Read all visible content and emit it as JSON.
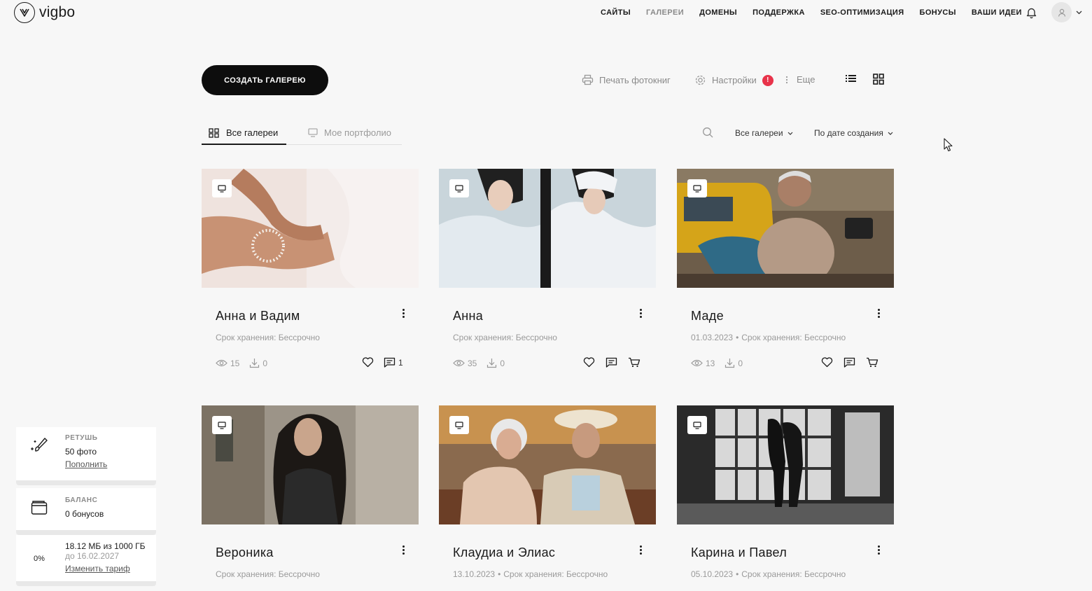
{
  "header": {
    "logo_text": "vigbo",
    "nav": [
      {
        "label": "САЙТЫ",
        "active": false
      },
      {
        "label": "ГАЛЕРЕИ",
        "active": true
      },
      {
        "label": "ДОМЕНЫ",
        "active": false
      },
      {
        "label": "ПОДДЕРЖКА",
        "active": false
      },
      {
        "label": "SEO-ОПТИМИЗАЦИЯ",
        "active": false
      },
      {
        "label": "БОНУСЫ",
        "active": false
      },
      {
        "label": "ВАШИ ИДЕИ",
        "active": false
      }
    ]
  },
  "toolbar": {
    "create_label": "СОЗДАТЬ ГАЛЕРЕЮ",
    "print_label": "Печать фотокниг",
    "settings_label": "Настройки",
    "settings_badge": "!",
    "more_label": "Еще"
  },
  "tabs": {
    "all_label": "Все галереи",
    "portfolio_label": "Мое портфолио"
  },
  "filters": {
    "scope": "Все галереи",
    "sort": "По дате создания"
  },
  "galleries": [
    {
      "title": "Анна и Вадим",
      "date": "",
      "storage": "Срок хранения: Бессрочно",
      "views": "15",
      "downloads": "0",
      "comments": "1",
      "cart": false
    },
    {
      "title": "Анна",
      "date": "",
      "storage": "Срок хранения: Бессрочно",
      "views": "35",
      "downloads": "0",
      "comments": "",
      "cart": true
    },
    {
      "title": "Маде",
      "date": "01.03.2023",
      "storage": "Срок хранения: Бессрочно",
      "views": "13",
      "downloads": "0",
      "comments": "",
      "cart": true
    },
    {
      "title": "Вероника",
      "date": "",
      "storage": "Срок хранения: Бессрочно"
    },
    {
      "title": "Клаудиа и Элиас",
      "date": "13.10.2023",
      "storage": "Срок хранения: Бессрочно"
    },
    {
      "title": "Карина и Павел",
      "date": "05.10.2023",
      "storage": "Срок хранения: Бессрочно"
    }
  ],
  "sidebar": {
    "retouch": {
      "label": "РЕТУШЬ",
      "value": "50 фото",
      "link": "Пополнить"
    },
    "balance": {
      "label": "БАЛАНС",
      "value": "0 бонусов"
    },
    "storage": {
      "percent": "0%",
      "used": "18.12 МБ из 1000 ГБ",
      "until": "до 16.02.2027",
      "link": "Изменить тариф",
      "fraction": 0.0
    }
  },
  "colors": {
    "accent": "#0d0d0d",
    "badge": "#e8334a",
    "muted": "#9a9a9a"
  }
}
